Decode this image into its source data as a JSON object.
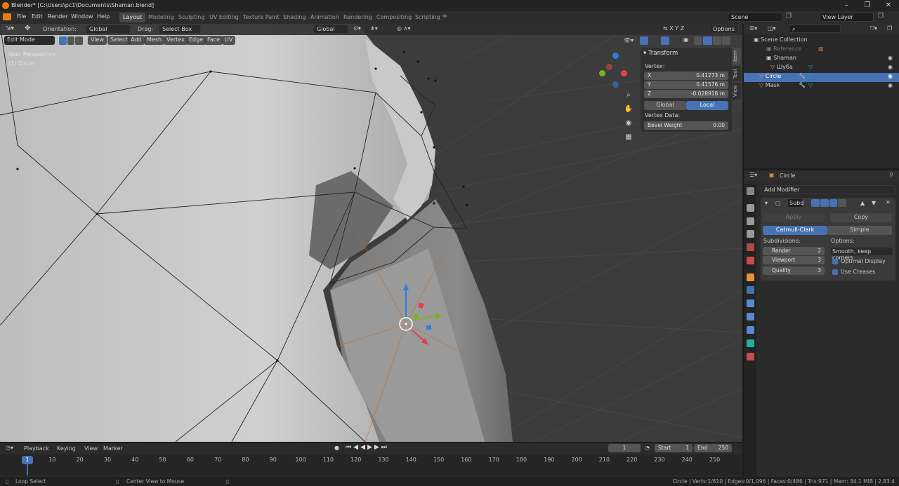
{
  "window": {
    "title": "Blender* [C:\\Users\\pc1\\Documents\\Shaman.blend]"
  },
  "menu": [
    "File",
    "Edit",
    "Render",
    "Window",
    "Help"
  ],
  "workspaces": [
    "Layout",
    "Modeling",
    "Sculpting",
    "UV Editing",
    "Texture Paint",
    "Shading",
    "Animation",
    "Rendering",
    "Compositing",
    "Scripting"
  ],
  "scene": {
    "name": "Scene",
    "view_layer": "View Layer"
  },
  "toolheader": {
    "orientation_label": "Orientation:",
    "orientation": "Global",
    "drag_label": "Drag:",
    "drag": "Select Box",
    "transform_orient": "Global",
    "options": "Options"
  },
  "vpheader": {
    "mode": "Edit Mode",
    "items": [
      "View",
      "Select",
      "Add",
      "Mesh",
      "Vertex",
      "Edge",
      "Face",
      "UV"
    ]
  },
  "viewport": {
    "perspective": "User Perspective",
    "object": "(1) Circle",
    "gizmo_labels": [
      "X",
      "Y",
      "Z"
    ],
    "colors": {
      "bg": "#3c3c3c",
      "x": "#e23f4b",
      "y": "#7bb325",
      "z": "#2d7fda"
    }
  },
  "npanel": {
    "title": "Transform",
    "vertex_label": "Vertex:",
    "x_label": "X",
    "x": "0.41273 m",
    "y_label": "Y",
    "y": "0.41576 m",
    "z_label": "Z",
    "z": "-0.028918 m",
    "global": "Global",
    "local": "Local",
    "vertex_data": "Vertex Data:",
    "bevel_label": "Bevel Weight",
    "bevel": "0.00",
    "tabs": [
      "Item",
      "Tool",
      "View"
    ]
  },
  "outliner": {
    "rows": [
      {
        "label": "Scene Collection",
        "selected": false
      },
      {
        "label": "Reference",
        "selected": false
      },
      {
        "label": "Shaman",
        "selected": false
      },
      {
        "label": "Шуба",
        "selected": false
      },
      {
        "label": "Circle",
        "selected": true
      },
      {
        "label": "Mask",
        "selected": false
      }
    ]
  },
  "properties": {
    "object": "Circle",
    "add_modifier": "Add Modifier",
    "modifier_name": "Subd",
    "apply": "Apply",
    "copy": "Copy",
    "catmull": "Catmull-Clark",
    "simple": "Simple",
    "subdivisions": "Subdivisions:",
    "render_label": "Render",
    "render": "2",
    "viewport_label": "Viewport",
    "viewport": "3",
    "quality_label": "Quality",
    "quality": "3",
    "options": "Options:",
    "uv_smooth": "Smooth, keep corners",
    "optimal": "Optimal Display",
    "creases": "Use Creases"
  },
  "timeline": {
    "menus": [
      "Playback",
      "Keying",
      "View",
      "Marker"
    ],
    "current": "1",
    "start_label": "Start",
    "start": "1",
    "end_label": "End",
    "end": "250",
    "ticks": [
      "1",
      "10",
      "20",
      "30",
      "40",
      "50",
      "60",
      "70",
      "80",
      "90",
      "100",
      "110",
      "120",
      "130",
      "140",
      "150",
      "160",
      "170",
      "180",
      "190",
      "200",
      "210",
      "220",
      "230",
      "240",
      "250"
    ]
  },
  "status": {
    "left": "Loop Select",
    "middle": "Center View to Mouse",
    "right": "Circle | Verts:1/610 | Edges:0/1,096 | Faces:0/486 | Tris:971 | Mem: 34.1 MiB | 2.83.4"
  }
}
